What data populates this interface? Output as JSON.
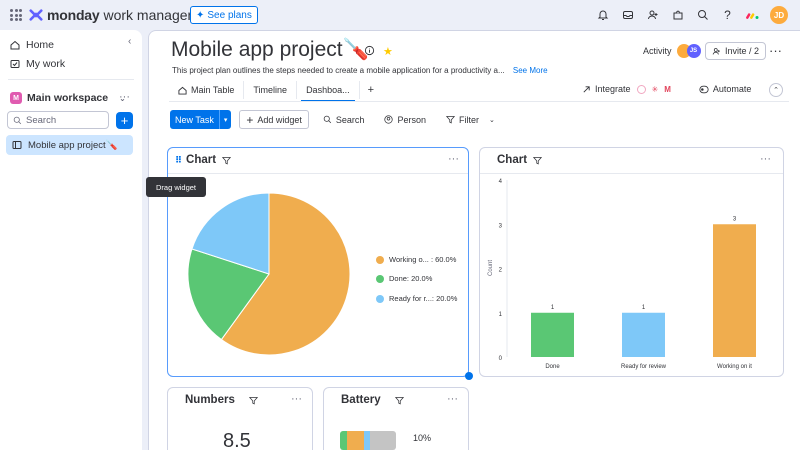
{
  "topbar": {
    "brand": "monday",
    "brand_sub": "work management",
    "see_plans": "See plans",
    "avatar": "JD",
    "icons": [
      "bell-icon",
      "inbox-icon",
      "invite-members-icon",
      "apps-icon",
      "search-icon",
      "help-icon"
    ]
  },
  "sidebar": {
    "home": "Home",
    "my_work": "My work",
    "workspace": "Main workspace",
    "workspace_badge": "M",
    "search_placeholder": "Search",
    "board": "Mobile app project🪛"
  },
  "header": {
    "title": "Mobile app project🪛",
    "description": "This project plan outlines the steps needed to create a mobile application for a productivity a...",
    "see_more": "See More",
    "activity": "Activity",
    "activity_avatar": "JS",
    "invite": "Invite / 2"
  },
  "tabs": [
    {
      "label": "Main Table"
    },
    {
      "label": "Timeline"
    },
    {
      "label": "Dashboa..."
    }
  ],
  "tabs_right": {
    "integrate": "Integrate",
    "automate": "Automate"
  },
  "toolbar": {
    "new_task": "New Task",
    "add_widget": "Add widget",
    "search": "Search",
    "person": "Person",
    "filter": "Filter"
  },
  "tooltip": "Drag widget",
  "widgets": {
    "pie_title": "Chart",
    "bar_title": "Chart",
    "numbers_title": "Numbers",
    "numbers_value": "8.5",
    "battery_title": "Battery",
    "battery_percent": "10%"
  },
  "colors": {
    "working": "#fdab3d",
    "done": "#00c875",
    "review": "#66ccff",
    "accent": "#0073ea"
  },
  "chart_data": [
    {
      "type": "pie",
      "slices": [
        {
          "label": "Working o...",
          "value": 60.0,
          "display": "Working o... : 60.0%",
          "color": "#f0ad4e"
        },
        {
          "label": "Done",
          "value": 20.0,
          "display": "Done: 20.0%",
          "color": "#5ac774"
        },
        {
          "label": "Ready for r...",
          "value": 20.0,
          "display": "Ready for r...: 20.0%",
          "color": "#7ec8f8"
        }
      ]
    },
    {
      "type": "bar",
      "categories": [
        "Done",
        "Ready for review",
        "Working on it"
      ],
      "values": [
        1,
        1,
        3
      ],
      "colors": [
        "#5ac774",
        "#7ec8f8",
        "#f0ad4e"
      ],
      "ylabel": "Count",
      "yticks": [
        "0",
        "1",
        "2",
        "3",
        "4"
      ],
      "ylim": [
        0,
        4
      ]
    }
  ]
}
